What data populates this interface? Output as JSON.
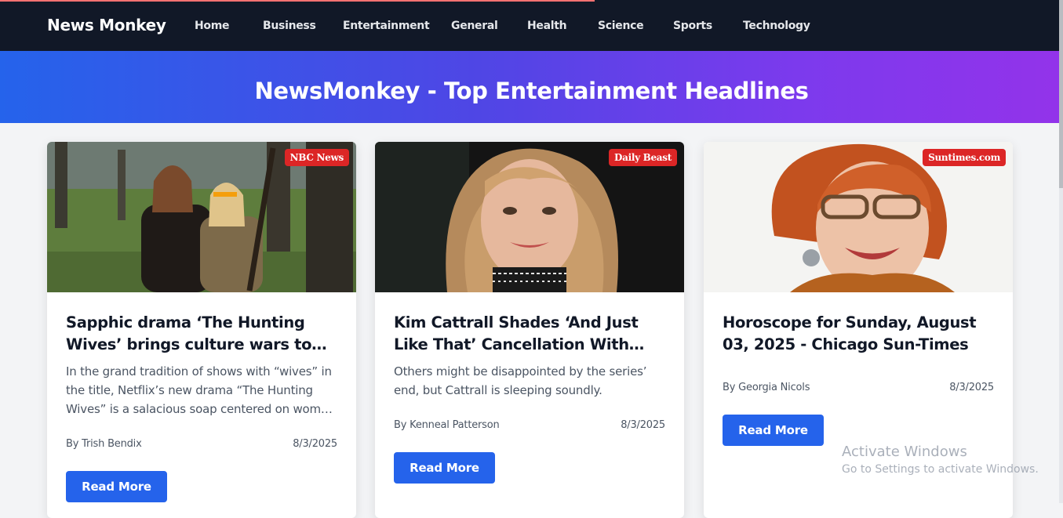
{
  "nav": {
    "brand": "News Monkey",
    "items": [
      "Home",
      "Business",
      "Entertainment",
      "General",
      "Health",
      "Science",
      "Sports",
      "Technology"
    ]
  },
  "hero": {
    "title": "NewsMonkey - Top Entertainment Headlines"
  },
  "colors": {
    "navbar": "#111827",
    "accent": "#2563eb",
    "badge": "#dc2626",
    "hero_from": "#2563eb",
    "hero_to": "#9333ea"
  },
  "cards": [
    {
      "source": "NBC News",
      "title": "Sapphic drama ‘The Hunting Wives’ brings culture wars to Netflix - NBC News",
      "description": "In the grand tradition of shows with “wives” in the title, Netflix’s new drama “The Hunting Wives” is a salacious soap centered on women who hunt",
      "author": "By Trish Bendix",
      "date": "8/3/2025",
      "button": "Read More"
    },
    {
      "source": "Daily Beast",
      "title": "Kim Cattrall Shades ‘And Just Like That’ Cancellation With Cryptic Post",
      "description": "Others might be disappointed by the series’ end, but Cattrall is sleeping soundly.",
      "author": "By Kenneal Patterson",
      "date": "8/3/2025",
      "button": "Read More"
    },
    {
      "source": "Suntimes.com",
      "title": "Horoscope for Sunday, August 03, 2025 - Chicago Sun-Times",
      "description": "",
      "author": "By Georgia Nicols",
      "date": "8/3/2025",
      "button": "Read More"
    }
  ],
  "watermark": {
    "line1": "Activate Windows",
    "line2": "Go to Settings to activate Windows."
  }
}
